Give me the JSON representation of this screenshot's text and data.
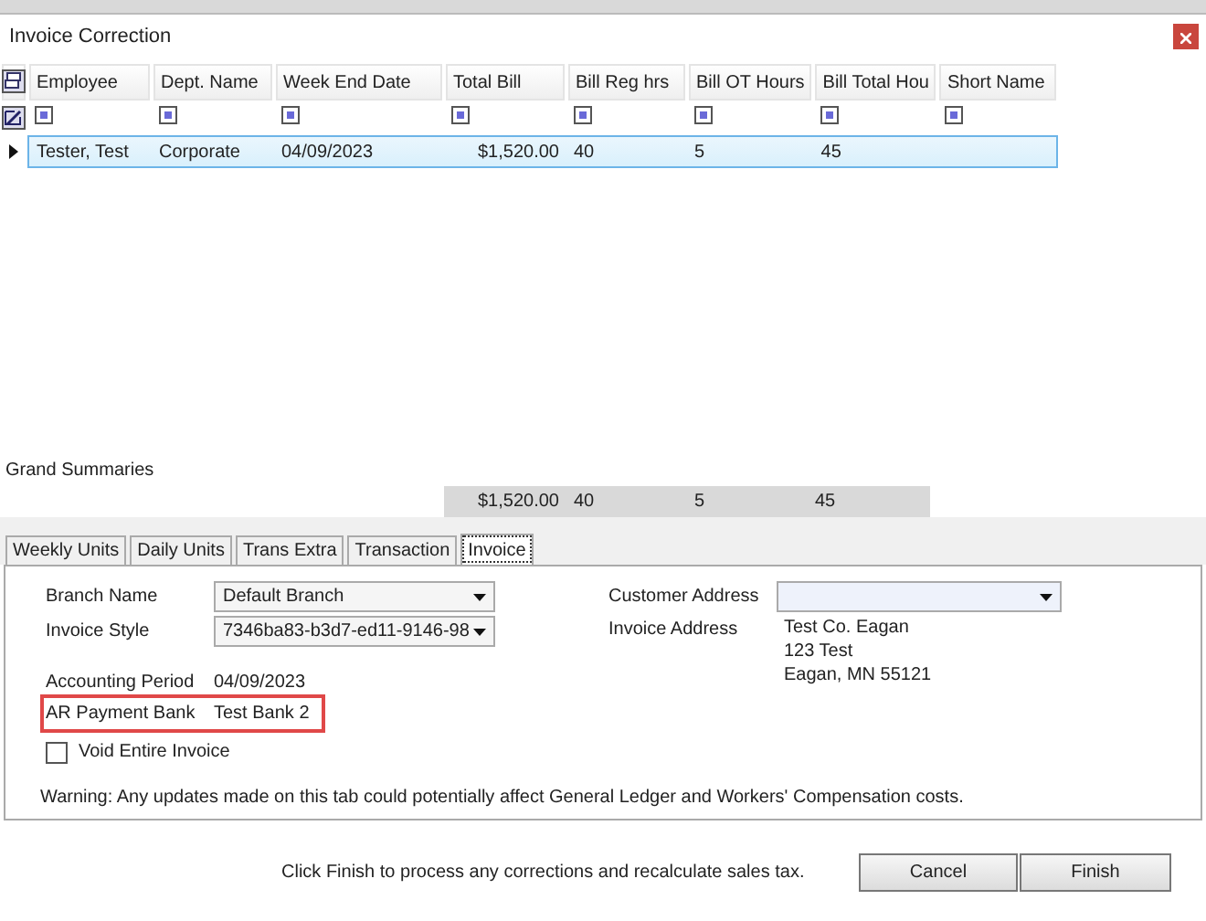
{
  "window": {
    "title": "Invoice Correction"
  },
  "grid": {
    "columns": [
      "Employee",
      "Dept. Name",
      "Week End Date",
      "Total Bill",
      "Bill Reg hrs",
      "Bill OT Hours",
      "Bill Total Hou",
      "Short Name"
    ],
    "rows": [
      {
        "selected": true,
        "cells": [
          "Tester, Test",
          "Corporate",
          "04/09/2023",
          "$1,520.00",
          "40",
          "5",
          "45",
          ""
        ]
      }
    ]
  },
  "grand_summaries": {
    "label": "Grand Summaries",
    "values": [
      "$1,520.00",
      "40",
      "5",
      "45"
    ]
  },
  "tabs": [
    {
      "label": "Weekly Units",
      "selected": false
    },
    {
      "label": "Daily Units",
      "selected": false
    },
    {
      "label": "Trans Extra",
      "selected": false
    },
    {
      "label": "Transaction",
      "selected": false
    },
    {
      "label": "Invoice",
      "selected": true
    }
  ],
  "invoice_tab": {
    "branch_name": {
      "label": "Branch Name",
      "value": "Default Branch"
    },
    "invoice_style": {
      "label": "Invoice Style",
      "value": "7346ba83-b3d7-ed11-9146-98"
    },
    "accounting_period": {
      "label": "Accounting Period",
      "value": "04/09/2023",
      "highlighted": false
    },
    "ar_payment_bank": {
      "label": "AR Payment Bank",
      "value": "Test Bank 2",
      "highlighted": true
    },
    "void_invoice": {
      "label": "Void Entire Invoice",
      "checked": false
    },
    "customer_address": {
      "label": "Customer Address"
    },
    "invoice_address": {
      "label": "Invoice Address",
      "lines": [
        "Test Co. Eagan",
        "123 Test",
        "Eagan, MN 55121"
      ]
    },
    "warning": "Warning: Any updates made on this tab could potentially affect General Ledger and Workers' Compensation costs."
  },
  "footer": {
    "message": "Click Finish to process any corrections and recalculate sales tax.",
    "buttons": [
      "Cancel",
      "Finish"
    ]
  }
}
